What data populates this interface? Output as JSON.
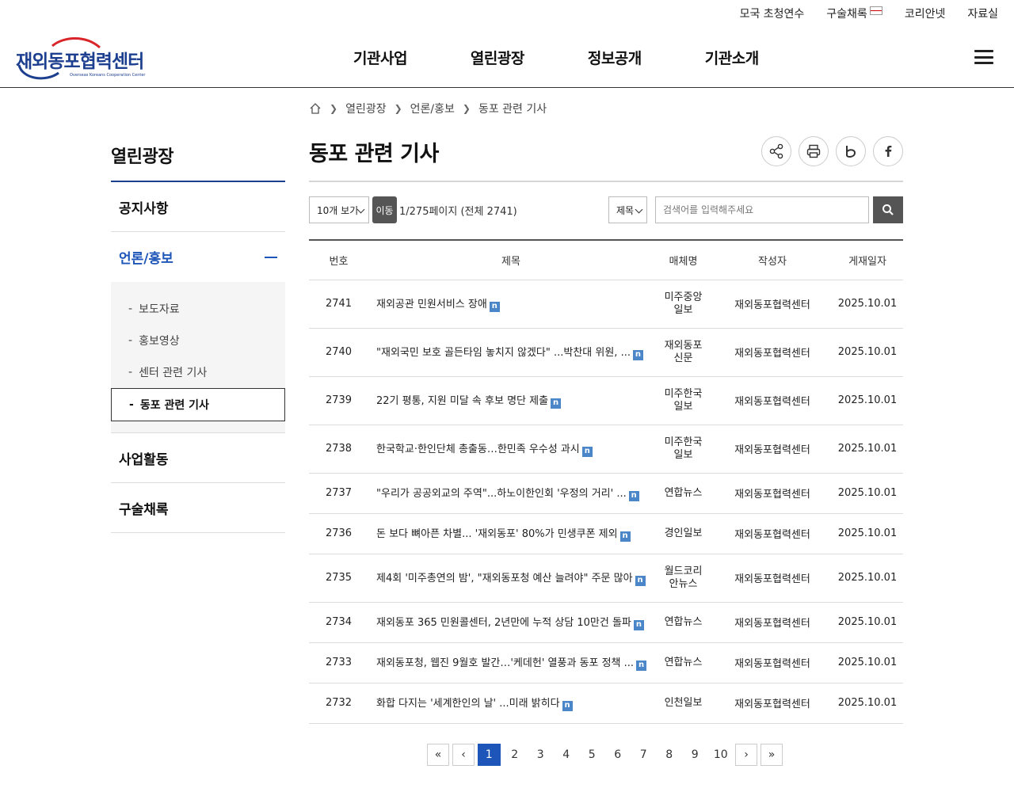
{
  "utility": [
    "모국 초청연수",
    "구술채록",
    "코리안넷",
    "자료실"
  ],
  "logo": {
    "name": "재외동포협력센터",
    "sub": "Overseas Koreans Cooperation Center"
  },
  "gnb": [
    "기관사업",
    "열린광장",
    "정보공개",
    "기관소개"
  ],
  "sidebar": {
    "title": "열린광장",
    "items": [
      {
        "label": "공지사항"
      },
      {
        "label": "언론/홍보"
      },
      {
        "label": "사업활동"
      },
      {
        "label": "구술채록"
      }
    ],
    "sub": [
      "보도자료",
      "홍보영상",
      "센터 관련 기사",
      "동포 관련 기사"
    ],
    "dash": "-"
  },
  "breadcrumb": [
    "열린광장",
    "언론/홍보",
    "동포 관련 기사"
  ],
  "page_title": "동포 관련 기사",
  "controls": {
    "per_page": "10개 보기",
    "go": "이동",
    "page_info": "1/275페이지 (전체 2741)",
    "search_field": "제목",
    "search_placeholder": "검색어를 입력해주세요"
  },
  "table": {
    "headers": [
      "번호",
      "제목",
      "매체명",
      "작성자",
      "게재일자"
    ],
    "badge": "n",
    "rows": [
      {
        "no": "2741",
        "title": "재외공관 민원서비스 장애",
        "media": [
          "미주중앙",
          "일보"
        ],
        "author": "재외동포협력센터",
        "date": "2025.10.01"
      },
      {
        "no": "2740",
        "title": "\"재외국민 보호 골든타임 놓치지 않겠다\" ...박찬대 위원, ...",
        "media": [
          "재외동포",
          "신문"
        ],
        "author": "재외동포협력센터",
        "date": "2025.10.01"
      },
      {
        "no": "2739",
        "title": "22기 평통, 지원 미달 속 후보 명단 제출",
        "media": [
          "미주한국",
          "일보"
        ],
        "author": "재외동포협력센터",
        "date": "2025.10.01"
      },
      {
        "no": "2738",
        "title": "한국학교·한인단체 총출동…한민족 우수성 과시",
        "media": [
          "미주한국",
          "일보"
        ],
        "author": "재외동포협력센터",
        "date": "2025.10.01"
      },
      {
        "no": "2737",
        "title": "\"우리가 공공외교의 주역\"...하노이한인회 '우정의 거리' ...",
        "media": [
          "연합뉴스"
        ],
        "author": "재외동포협력센터",
        "date": "2025.10.01"
      },
      {
        "no": "2736",
        "title": "돈 보다 뼈아픈 차별... '재외동포' 80%가 민생쿠폰 제외",
        "media": [
          "경인일보"
        ],
        "author": "재외동포협력센터",
        "date": "2025.10.01"
      },
      {
        "no": "2735",
        "title": "제4회 '미주총연의 밤', \"재외동포청 예산 늘려야\" 주문 많아",
        "media": [
          "월드코리",
          "안뉴스"
        ],
        "author": "재외동포협력센터",
        "date": "2025.10.01"
      },
      {
        "no": "2734",
        "title": "재외동포 365 민원콜센터, 2년만에 누적 상담 10만건 돌파",
        "media": [
          "연합뉴스"
        ],
        "author": "재외동포협력센터",
        "date": "2025.10.01"
      },
      {
        "no": "2733",
        "title": "재외동포청, 웹진 9월호 발간…'케데헌' 열풍과 동포 정책 ...",
        "media": [
          "연합뉴스"
        ],
        "author": "재외동포협력센터",
        "date": "2025.10.01"
      },
      {
        "no": "2732",
        "title": "화합 다지는 '세계한인의 날' ...미래 밝히다",
        "media": [
          "인천일보"
        ],
        "author": "재외동포협력센터",
        "date": "2025.10.01"
      }
    ]
  },
  "pagination": {
    "first": "«",
    "prev": "‹",
    "next": "›",
    "last": "»",
    "pages": [
      "1",
      "2",
      "3",
      "4",
      "5",
      "6",
      "7",
      "8",
      "9",
      "10"
    ],
    "current": "1"
  },
  "colors": {
    "brand": "#1d3f8f",
    "accent": "#1d56b8",
    "badge": "#4a86c8"
  }
}
